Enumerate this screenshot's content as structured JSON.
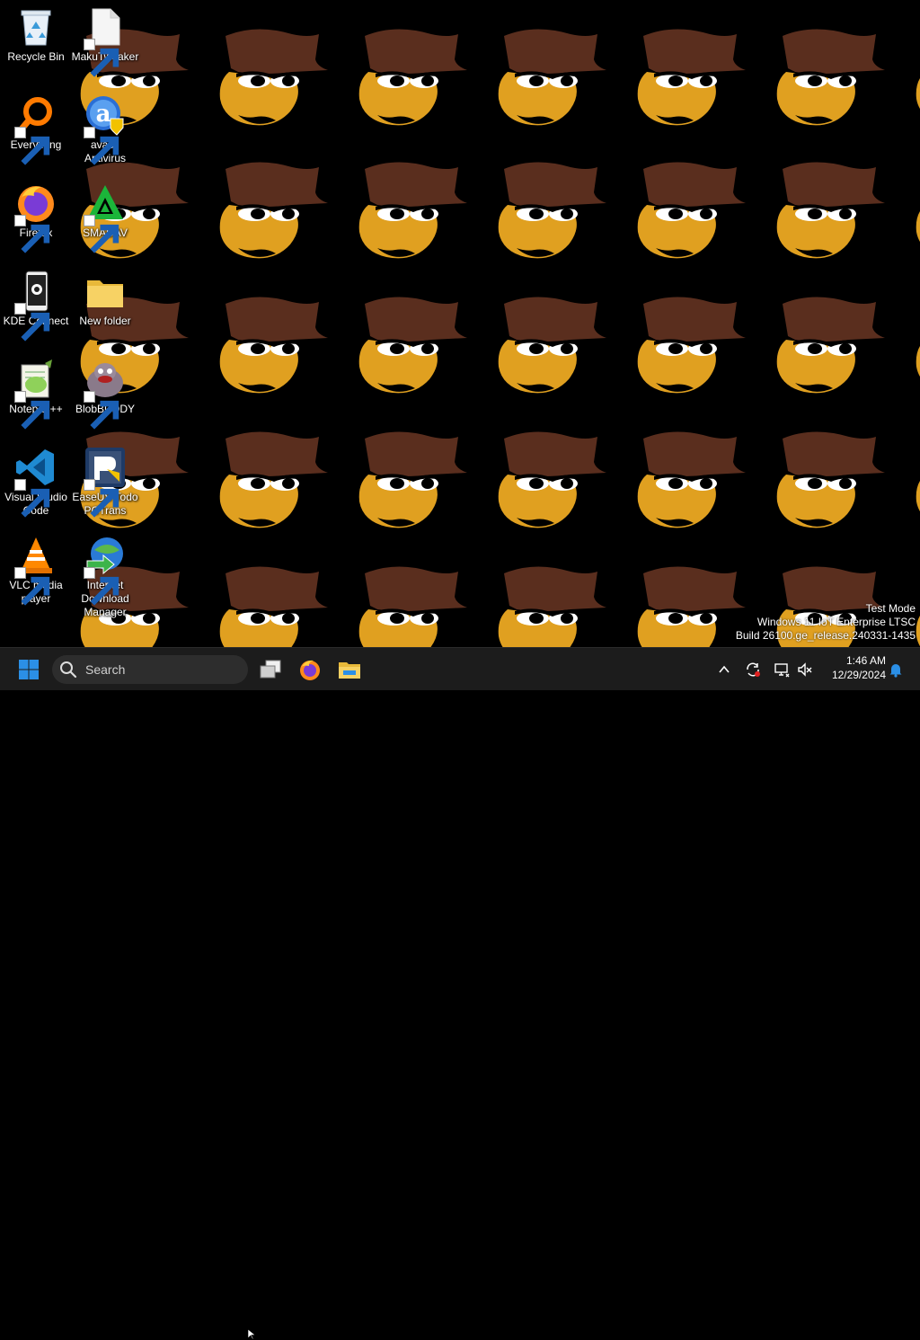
{
  "desktop": {
    "icons": [
      {
        "label": "Recycle Bin",
        "icon": "recycle-bin-icon"
      },
      {
        "label": "MakuTweaker",
        "icon": "blank-file-icon"
      },
      {
        "label": "Everything",
        "icon": "everything-search-icon"
      },
      {
        "label": "avast!\nAntivirus",
        "icon": "avast-icon"
      },
      {
        "label": "Firefox",
        "icon": "firefox-icon"
      },
      {
        "label": "SMADAV",
        "icon": "smadav-icon"
      },
      {
        "label": "KDE Connect",
        "icon": "kde-connect-icon"
      },
      {
        "label": "New folder",
        "icon": "folder-icon"
      },
      {
        "label": "Notepad++",
        "icon": "notepad-plus-plus-icon"
      },
      {
        "label": "BlobBUDDY",
        "icon": "blobbuddy-icon"
      },
      {
        "label": "Visual Studio\nCode",
        "icon": "vscode-icon"
      },
      {
        "label": "EaseUS Todo\nPCTrans",
        "icon": "easeus-todo-pctrans-icon"
      },
      {
        "label": "VLC media\nplayer",
        "icon": "vlc-icon"
      },
      {
        "label": "Internet\nDownload\nManager",
        "icon": "internet-download-manager-icon"
      }
    ],
    "watermark": {
      "line1": "Test Mode",
      "line2": "Windows 11 IoT Enterprise LTSC",
      "line3": "Build 26100.ge_release.240331-1435"
    }
  },
  "taskbar": {
    "start_icon": "windows-start-icon",
    "search_placeholder": "Search",
    "pinned": [
      "task-view-icon",
      "firefox-icon",
      "file-explorer-icon"
    ],
    "tray": [
      "chevron-up-icon",
      "sync-update-icon",
      "network-icon",
      "volume-muted-icon"
    ],
    "clock_time": "1:46 AM",
    "clock_date": "12/29/2024",
    "notification_icon": "bell-icon"
  },
  "colors": {
    "wallpaper_bg": "#000000",
    "hat": "#5a2e1e",
    "face": "#e0a020",
    "taskbar": "#1c1c1c",
    "accent": "#2b8fe6"
  }
}
